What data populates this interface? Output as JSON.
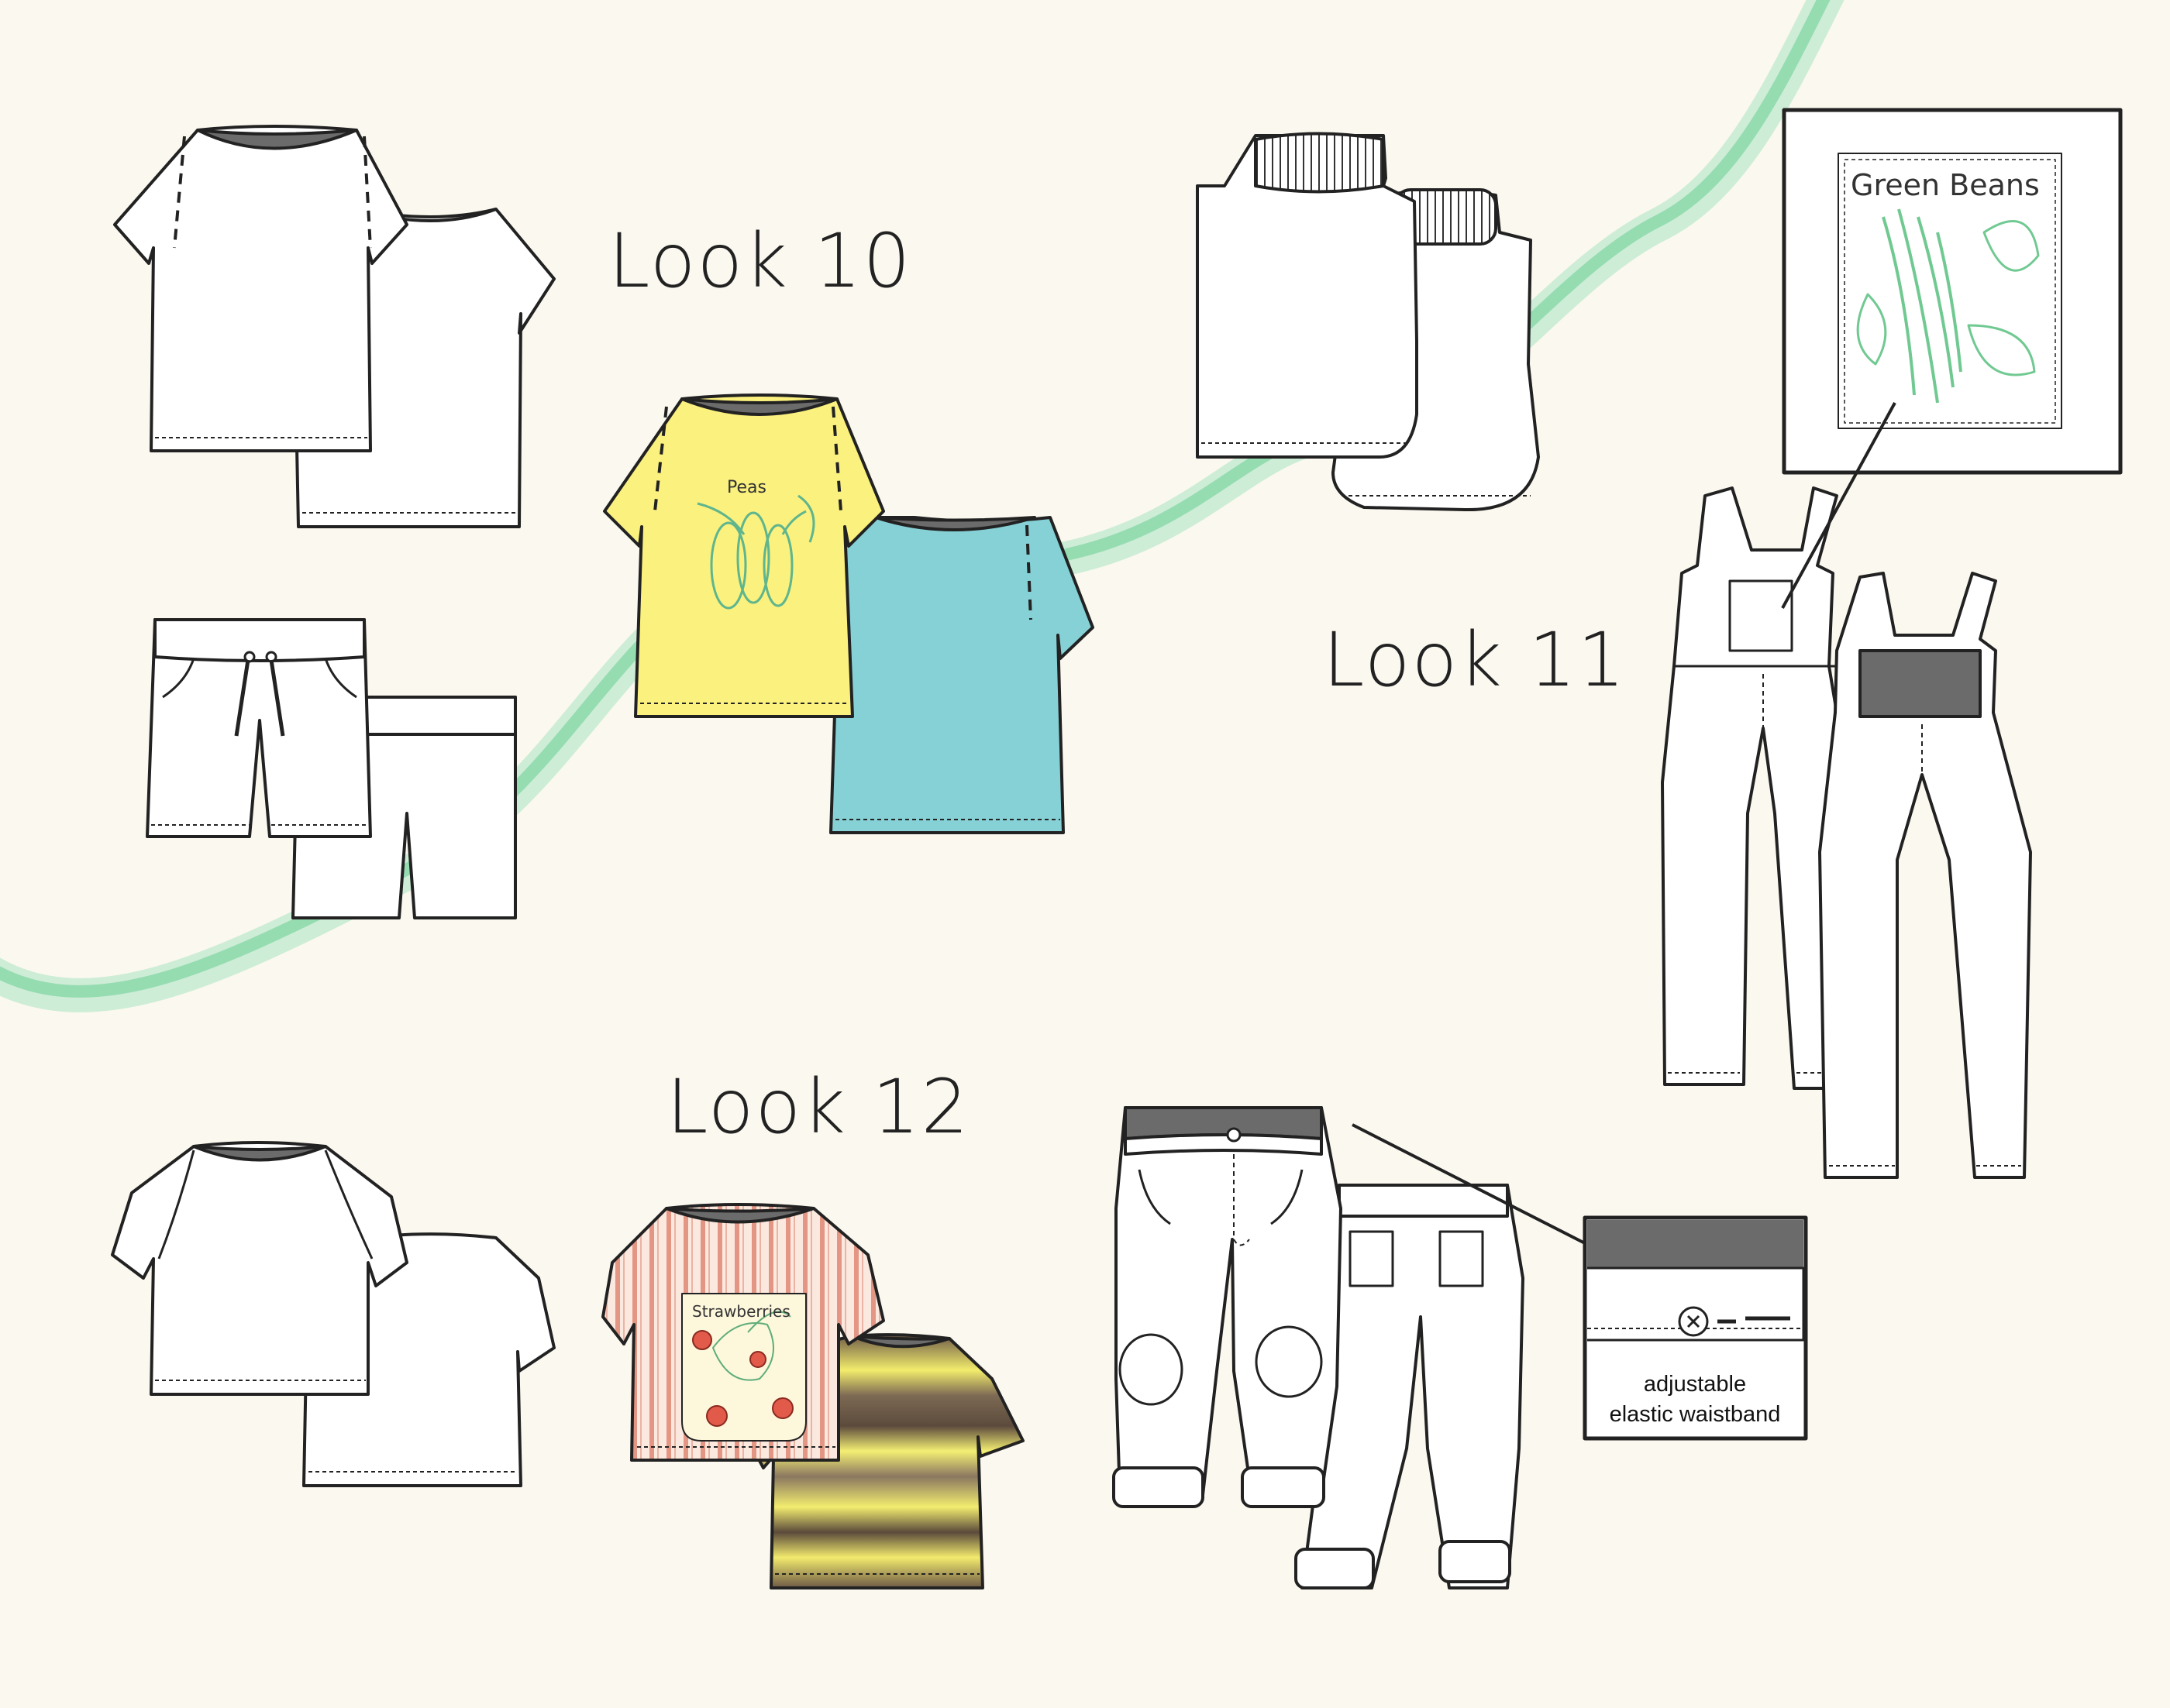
{
  "looks": [
    {
      "title": "Look 10"
    },
    {
      "title": "Look 11"
    },
    {
      "title": "Look 12"
    }
  ],
  "prints": {
    "peas": "Peas",
    "green_beans": "Green Beans",
    "strawberries": "Strawberries"
  },
  "callout": {
    "line1": "adjustable",
    "line2": "elastic waistband"
  },
  "colors": {
    "background": "#fbf8ef",
    "swoosh": "#8fd9ad",
    "yellow_tee": "#fbf17e",
    "teal_tee": "#86d1d6",
    "neck_grey": "#6b6b6b",
    "outline": "#222222"
  }
}
